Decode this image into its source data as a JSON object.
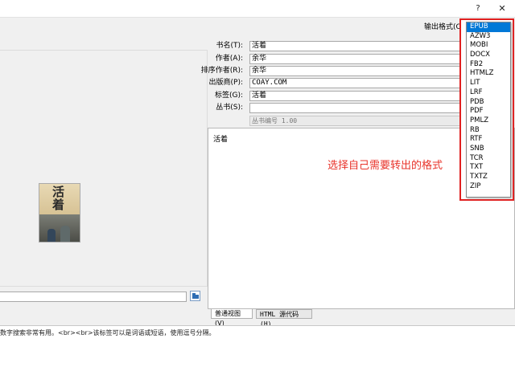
{
  "titlebar": {
    "help": "?",
    "close": "✕"
  },
  "cover": {
    "title": "活着"
  },
  "metadata": [
    {
      "key": "title",
      "label": "书名(T):",
      "value": "活着"
    },
    {
      "key": "author",
      "label": "作者(A):",
      "value": "余华"
    },
    {
      "key": "author_sort",
      "label": "排序作者(R):",
      "value": "余华"
    },
    {
      "key": "publisher",
      "label": "出版商(P):",
      "value": "COAY.COM"
    },
    {
      "key": "tags",
      "label": "标签(G):",
      "value": "活着"
    },
    {
      "key": "series",
      "label": "丛书(S):",
      "value": ""
    }
  ],
  "series_number": "丛书编号 1.00",
  "output_format_label": "输出格式(O)",
  "formats": [
    "EPUB",
    "AZW3",
    "MOBI",
    "DOCX",
    "FB2",
    "HTMLZ",
    "LIT",
    "LRF",
    "PDB",
    "PDF",
    "PMLZ",
    "RB",
    "RTF",
    "SNB",
    "TCR",
    "TXT",
    "TXTZ",
    "ZIP"
  ],
  "selected_format": "EPUB",
  "comment_editor": {
    "text": "活着"
  },
  "annotation": "选择自己需要转出的格式",
  "tabs": {
    "normal": "普通视图(V)",
    "html": "HTML 源代码(H)"
  },
  "comments_help": "数字搜索非常有用。<br><br>该标签可以是词语或短语，使用逗号分隔。"
}
